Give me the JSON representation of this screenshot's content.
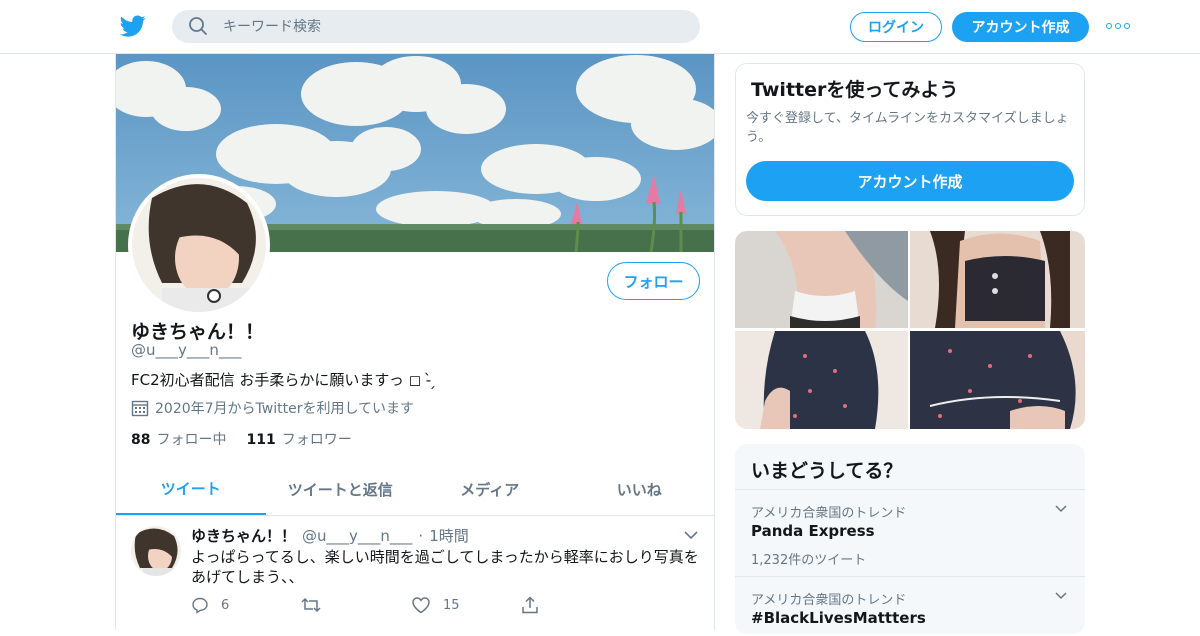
{
  "header": {
    "search_placeholder": "キーワード検索",
    "login_label": "ログイン",
    "signup_label": "アカウント作成"
  },
  "profile": {
    "name": "ゆきちゃん！！",
    "handle": "@u___y___n___",
    "bio": "FC2初心者配信  お手柔らかに願いますっ ◻ -̀ ̗",
    "joined": "2020年7月からTwitterを利用しています",
    "following_count": "88",
    "following_label": "フォロー中",
    "followers_count": "111",
    "followers_label": "フォロワー",
    "follow_button": "フォロー"
  },
  "tabs": [
    {
      "label": "ツイート"
    },
    {
      "label": "ツイートと返信"
    },
    {
      "label": "メディア"
    },
    {
      "label": "いいね"
    }
  ],
  "tweet": {
    "name": "ゆきちゃん！！",
    "handle": "@u___y___n___",
    "separator": "·",
    "time": "1時間",
    "text": "よっぱらってるし、楽しい時間を過ごしてしまったから軽率におしり写真をあげてしまう、、",
    "reply_count": "6",
    "retweet_count": "",
    "like_count": "15"
  },
  "signup_box": {
    "title": "Twitterを使ってみよう",
    "description": "今すぐ登録して、タイムラインをカスタマイズしましょう。",
    "button": "アカウント作成"
  },
  "trends": {
    "title": "いまどうしてる？",
    "items": [
      {
        "context": "アメリカ合衆国のトレンド",
        "name": "Panda Express",
        "count": "1,232件のツイート"
      },
      {
        "context": "アメリカ合衆国のトレンド",
        "name": "#BlackLivesMattters",
        "count": ""
      }
    ]
  },
  "colors": {
    "accent": "#1da1f2",
    "secondary_text": "#657786",
    "border": "#e1e8ed"
  }
}
